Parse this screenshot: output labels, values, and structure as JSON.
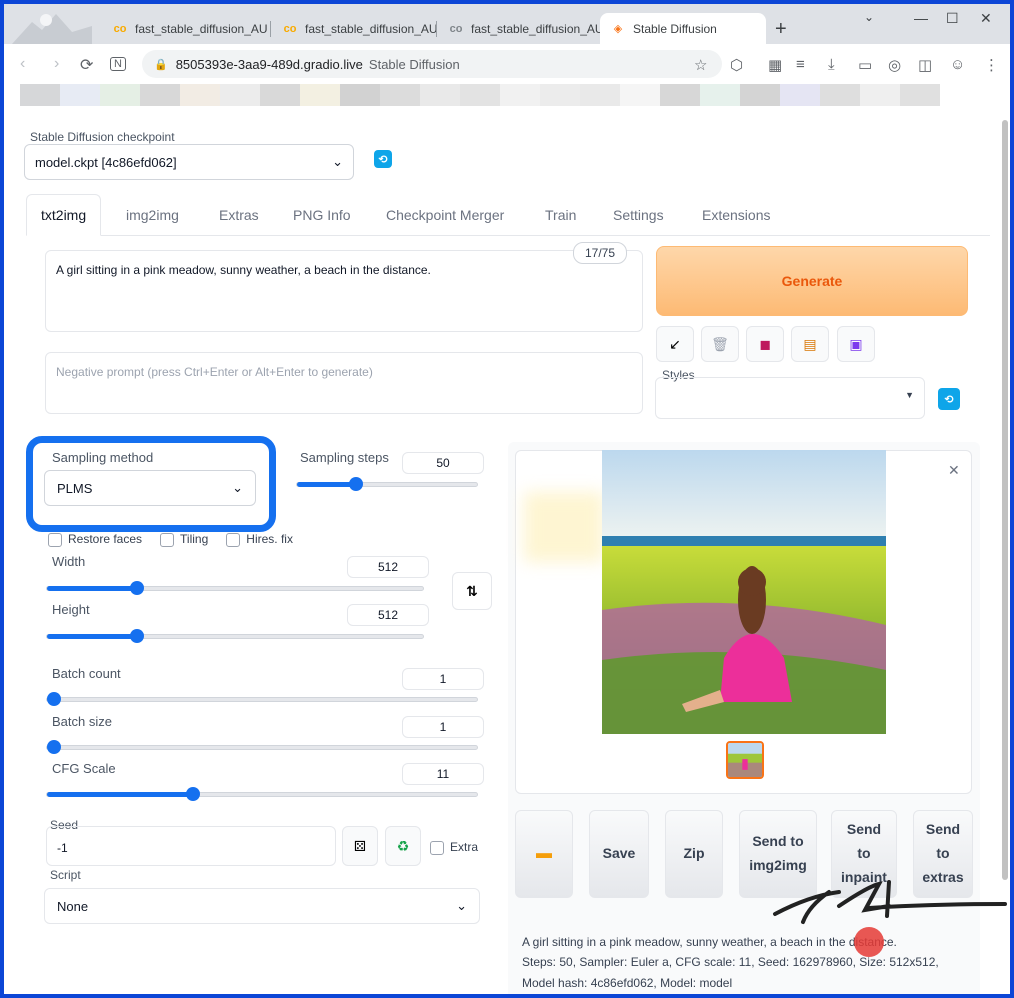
{
  "browser": {
    "tabs": [
      {
        "title": "fast_stable_diffusion_AU",
        "icon": "colab-icon"
      },
      {
        "title": "fast_stable_diffusion_AU",
        "icon": "colab-icon"
      },
      {
        "title": "fast_stable_diffusion_AU",
        "icon": "colab-icon"
      },
      {
        "title": "Stable Diffusion",
        "icon": "gradio-icon"
      }
    ],
    "url": "8505393e-3aa9-489d.gradio.live",
    "page_title": "Stable Diffusion"
  },
  "checkpoint": {
    "label": "Stable Diffusion checkpoint",
    "value": "model.ckpt [4c86efd062]"
  },
  "app_tabs": [
    "txt2img",
    "img2img",
    "Extras",
    "PNG Info",
    "Checkpoint Merger",
    "Train",
    "Settings",
    "Extensions"
  ],
  "prompt": {
    "value": "A girl sitting in a pink meadow, sunny weather, a beach in the distance.",
    "token_count": "17/75",
    "negative_placeholder": "Negative prompt (press Ctrl+Enter or Alt+Enter to generate)"
  },
  "generate_label": "Generate",
  "tool_icons": [
    "arrow-icon",
    "trash-icon",
    "bookmark-icon",
    "clipboard-icon",
    "save-icon"
  ],
  "styles_label": "Styles",
  "sampling": {
    "method_label": "Sampling method",
    "method_value": "PLMS",
    "steps_label": "Sampling steps",
    "steps_value": "50",
    "steps_fraction": 0.33
  },
  "checkboxes": [
    "Restore faces",
    "Tiling",
    "Hires. fix"
  ],
  "width": {
    "label": "Width",
    "value": "512",
    "fraction": 0.24
  },
  "height": {
    "label": "Height",
    "value": "512",
    "fraction": 0.24
  },
  "batch_count": {
    "label": "Batch count",
    "value": "1",
    "fraction": 0.0
  },
  "batch_size": {
    "label": "Batch size",
    "value": "1",
    "fraction": 0.0
  },
  "cfg_scale": {
    "label": "CFG Scale",
    "value": "11",
    "fraction": 0.34
  },
  "seed": {
    "label": "Seed",
    "value": "-1",
    "extra_label": "Extra"
  },
  "script": {
    "label": "Script",
    "value": "None"
  },
  "gallery_actions": {
    "save": "Save",
    "zip": "Zip",
    "send_img2img_l1": "Send to",
    "send_img2img_l2": "img2img",
    "send_inpaint_l1": "Send",
    "send_inpaint_l2": "to",
    "send_inpaint_l3": "inpaint",
    "send_extras_l1": "Send",
    "send_extras_l2": "to",
    "send_extras_l3": "extras"
  },
  "generation_info": {
    "line1": "A girl sitting in a pink meadow, sunny weather, a beach in the distance.",
    "line2": "Steps: 50, Sampler: Euler a, CFG scale: 11, Seed: 162978960, Size: 512x512,",
    "line3": "Model hash: 4c86efd062, Model: model"
  },
  "colors": {
    "accent": "#1570ef",
    "generate": "#ea580c",
    "highlight_border": "#1570ef"
  }
}
